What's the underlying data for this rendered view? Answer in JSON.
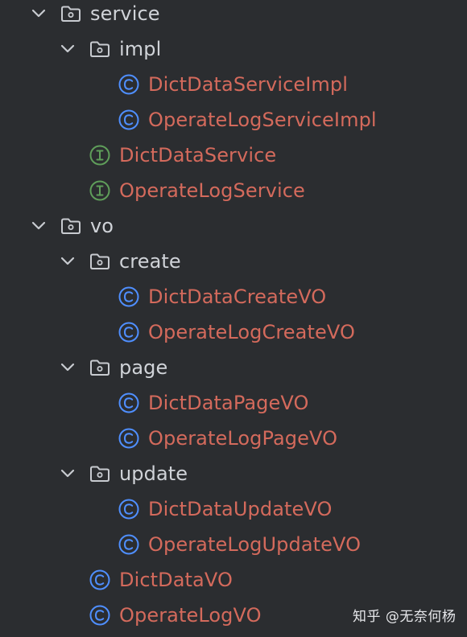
{
  "colors": {
    "background": "#2b2d30",
    "folder_text": "#d0d3d8",
    "file_text": "#d46a5c",
    "class_icon": "#4f8fff",
    "interface_icon": "#5f9e5a",
    "folder_icon": "#c8cbd0",
    "chevron": "#c8cbd0"
  },
  "tree": [
    {
      "label": "service",
      "kind": "folder",
      "depth": 0,
      "expanded": true,
      "icon": "folder-icon"
    },
    {
      "label": "impl",
      "kind": "folder",
      "depth": 1,
      "expanded": true,
      "icon": "folder-icon"
    },
    {
      "label": "DictDataServiceImpl",
      "kind": "class",
      "depth": 2,
      "icon": "class-icon"
    },
    {
      "label": "OperateLogServiceImpl",
      "kind": "class",
      "depth": 2,
      "icon": "class-icon"
    },
    {
      "label": "DictDataService",
      "kind": "interface",
      "depth": 1,
      "icon": "interface-icon"
    },
    {
      "label": "OperateLogService",
      "kind": "interface",
      "depth": 1,
      "icon": "interface-icon"
    },
    {
      "label": "vo",
      "kind": "folder",
      "depth": 0,
      "expanded": true,
      "icon": "folder-icon"
    },
    {
      "label": "create",
      "kind": "folder",
      "depth": 1,
      "expanded": true,
      "icon": "folder-icon"
    },
    {
      "label": "DictDataCreateVO",
      "kind": "class",
      "depth": 2,
      "icon": "class-icon"
    },
    {
      "label": "OperateLogCreateVO",
      "kind": "class",
      "depth": 2,
      "icon": "class-icon"
    },
    {
      "label": "page",
      "kind": "folder",
      "depth": 1,
      "expanded": true,
      "icon": "folder-icon"
    },
    {
      "label": "DictDataPageVO",
      "kind": "class",
      "depth": 2,
      "icon": "class-icon"
    },
    {
      "label": "OperateLogPageVO",
      "kind": "class",
      "depth": 2,
      "icon": "class-icon"
    },
    {
      "label": "update",
      "kind": "folder",
      "depth": 1,
      "expanded": true,
      "icon": "folder-icon"
    },
    {
      "label": "DictDataUpdateVO",
      "kind": "class",
      "depth": 2,
      "icon": "class-icon"
    },
    {
      "label": "OperateLogUpdateVO",
      "kind": "class",
      "depth": 2,
      "icon": "class-icon"
    },
    {
      "label": "DictDataVO",
      "kind": "class",
      "depth": 1,
      "icon": "class-icon"
    },
    {
      "label": "OperateLogVO",
      "kind": "class",
      "depth": 1,
      "icon": "class-icon"
    }
  ],
  "watermark": "知乎 @无奈何杨"
}
